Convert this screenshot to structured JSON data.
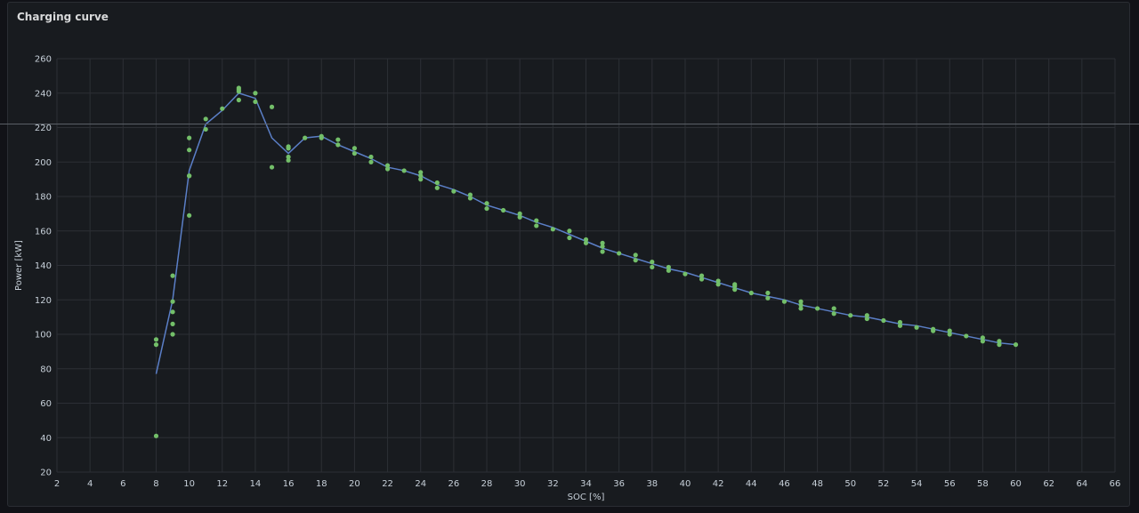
{
  "panel": {
    "title": "Charging curve"
  },
  "colors": {
    "background": "#111217",
    "panel": "#181b1f",
    "grid": "#2c2f35",
    "line": "#5b7fc7",
    "points": "#73bf69",
    "text": "#c7d0d9"
  },
  "chart_data": {
    "type": "scatter",
    "xlabel": "SOC [%]",
    "ylabel": "Power [kW]",
    "xlim": [
      2,
      66
    ],
    "ylim": [
      20,
      260
    ],
    "xticks": [
      2,
      4,
      6,
      8,
      10,
      12,
      14,
      16,
      18,
      20,
      22,
      24,
      26,
      28,
      30,
      32,
      34,
      36,
      38,
      40,
      42,
      44,
      46,
      48,
      50,
      52,
      54,
      56,
      58,
      60,
      62,
      64,
      66
    ],
    "yticks": [
      20,
      40,
      60,
      80,
      100,
      120,
      140,
      160,
      180,
      200,
      220,
      240,
      260
    ],
    "grid": true,
    "series": [
      {
        "type": "line",
        "x": [
          8,
          9,
          10,
          11,
          12,
          13,
          14,
          15,
          16,
          17,
          18,
          19,
          20,
          21,
          22,
          23,
          24,
          25,
          26,
          27,
          28,
          29,
          30,
          31,
          32,
          33,
          34,
          35,
          36,
          37,
          38,
          39,
          40,
          41,
          42,
          43,
          44,
          45,
          46,
          47,
          48,
          49,
          50,
          51,
          52,
          53,
          54,
          55,
          56,
          57,
          58,
          59,
          60
        ],
        "y": [
          77,
          120,
          195,
          222,
          230,
          240,
          237,
          214,
          205,
          214,
          215,
          210,
          206,
          202,
          197,
          195,
          192,
          187,
          184,
          180,
          175,
          172,
          169,
          165,
          162,
          158,
          154,
          150,
          147,
          144,
          141,
          138,
          136,
          133,
          130,
          127,
          124,
          122,
          120,
          117,
          115,
          113,
          111,
          110,
          108,
          106,
          105,
          103,
          101,
          99,
          97,
          95,
          94
        ]
      },
      {
        "type": "scatter",
        "x": [
          8,
          8,
          8,
          9,
          9,
          9,
          9,
          9,
          10,
          10,
          10,
          10,
          10,
          11,
          11,
          12,
          13,
          13,
          13,
          13,
          14,
          14,
          15,
          15,
          16,
          16,
          16,
          16,
          17,
          18,
          18,
          19,
          19,
          20,
          20,
          21,
          21,
          22,
          22,
          23,
          24,
          24,
          24,
          25,
          25,
          26,
          27,
          27,
          28,
          28,
          29,
          30,
          30,
          31,
          31,
          32,
          33,
          33,
          34,
          34,
          35,
          35,
          35,
          36,
          37,
          37,
          38,
          38,
          39,
          39,
          40,
          41,
          41,
          42,
          42,
          43,
          43,
          43,
          44,
          45,
          45,
          46,
          47,
          47,
          47,
          48,
          49,
          49,
          50,
          51,
          51,
          52,
          53,
          53,
          54,
          55,
          55,
          56,
          56,
          57,
          58,
          58,
          59,
          59,
          60
        ],
        "y": [
          41,
          94,
          97,
          100,
          106,
          113,
          119,
          134,
          169,
          192,
          207,
          214,
          192,
          219,
          225,
          231,
          236,
          241,
          242,
          243,
          235,
          240,
          197,
          232,
          201,
          203,
          208,
          209,
          214,
          214,
          215,
          210,
          213,
          205,
          208,
          200,
          203,
          196,
          198,
          195,
          190,
          192,
          194,
          185,
          188,
          183,
          179,
          181,
          173,
          176,
          172,
          168,
          170,
          163,
          166,
          161,
          156,
          160,
          153,
          155,
          148,
          151,
          153,
          147,
          143,
          146,
          139,
          142,
          137,
          139,
          135,
          132,
          134,
          129,
          131,
          126,
          128,
          129,
          124,
          121,
          124,
          119,
          115,
          117,
          119,
          115,
          112,
          115,
          111,
          109,
          111,
          108,
          105,
          107,
          104,
          102,
          103,
          100,
          102,
          99,
          96,
          98,
          94,
          96,
          94
        ]
      }
    ]
  }
}
